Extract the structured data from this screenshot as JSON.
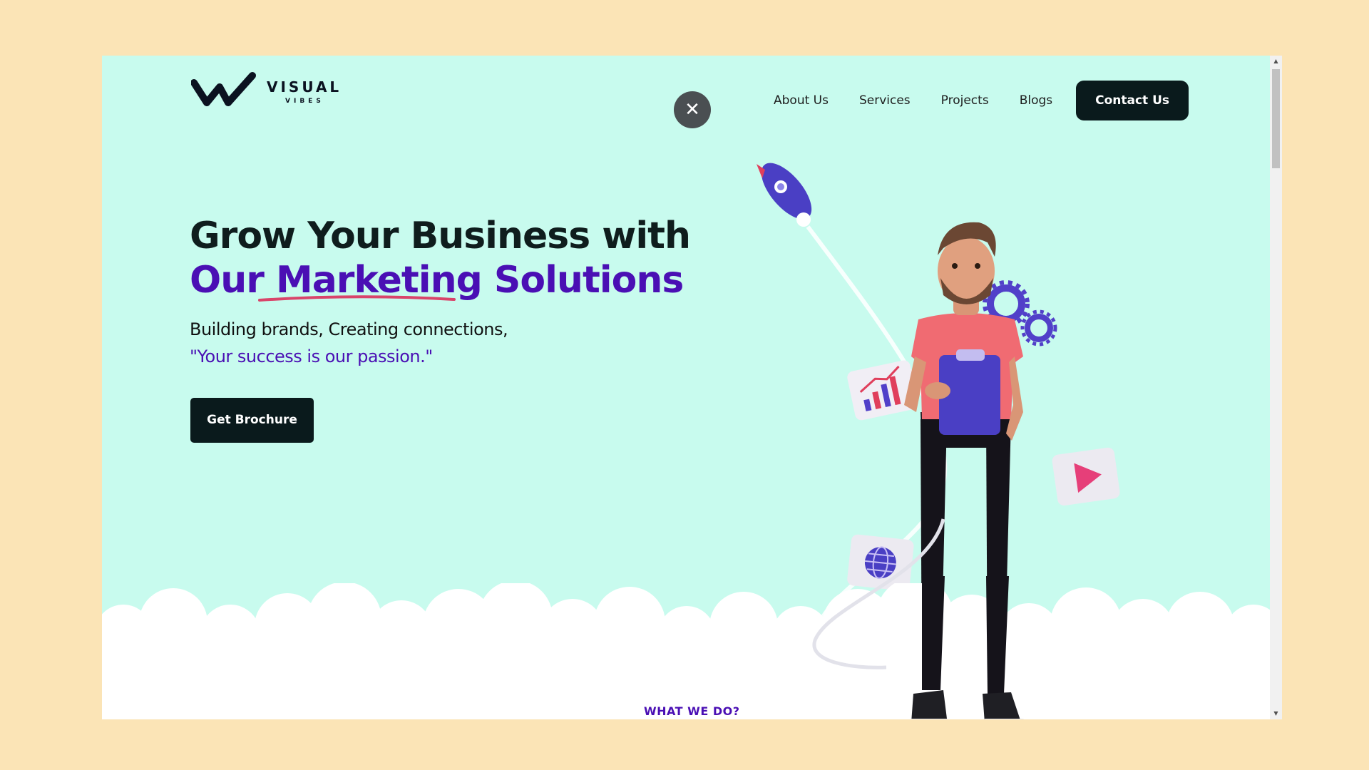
{
  "brand": {
    "name": "VISUAL",
    "tagline": "VIBES"
  },
  "nav": {
    "items": [
      {
        "label": "About Us"
      },
      {
        "label": "Services"
      },
      {
        "label": "Projects"
      },
      {
        "label": "Blogs"
      }
    ],
    "contact_label": "Contact Us"
  },
  "close_icon": "close-icon",
  "hero": {
    "title_line1": "Grow Your Business with",
    "title_line2": "Our Marketing Solutions",
    "subtitle": "Building brands, Creating connections,",
    "quote": "\"Your success is our passion.\"",
    "cta_label": "Get Brochure"
  },
  "next_section": {
    "label": "WHAT WE DO?"
  },
  "icons": {
    "rocket": "rocket-icon",
    "gears": "gears-icon",
    "chart_card": "bar-chart-icon",
    "play_card": "play-icon",
    "globe_card": "globe-icon"
  },
  "colors": {
    "page_bg": "#fbe4b6",
    "hero_bg": "#c8fbee",
    "accent_purple": "#4a0fb4",
    "button_dark": "#0a1a1c",
    "underline_red": "#d9446a"
  }
}
